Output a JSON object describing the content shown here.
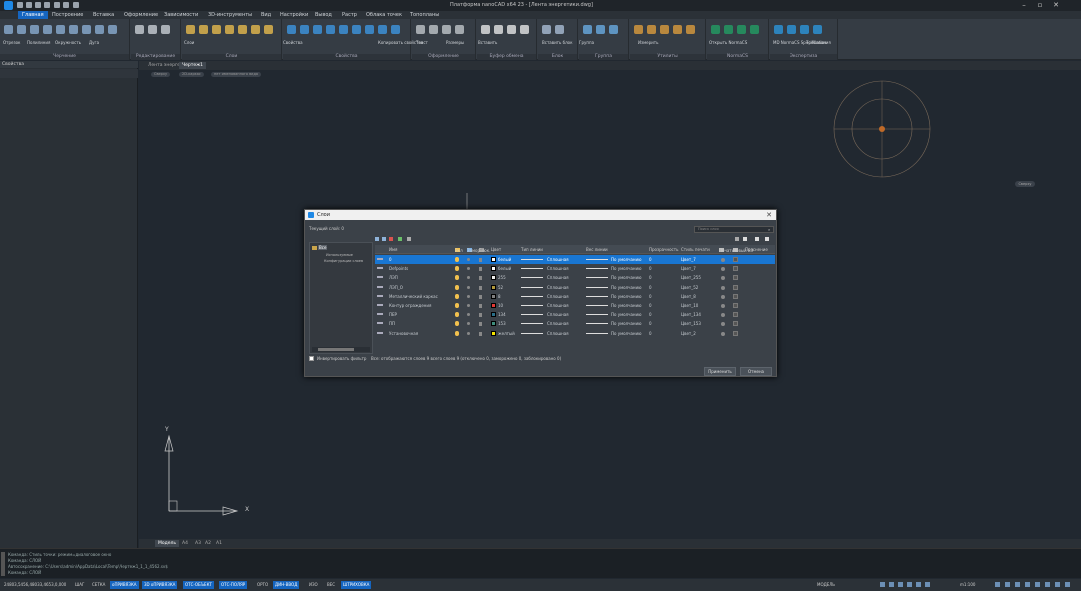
{
  "window": {
    "title": "Платформа nanoCAD x64 23 - [Лента энергетики.dwg]"
  },
  "menu": {
    "items": [
      "Главная",
      "Построение",
      "Вставка",
      "Оформление",
      "Зависимости",
      "3D-инструменты",
      "Вид",
      "Настройки",
      "Вывод",
      "Растр",
      "Облака точек",
      "Топопланы"
    ],
    "active": "Главная"
  },
  "ribbon": {
    "groups": [
      "Черчение",
      "Редактирование",
      "Слои",
      "Свойства",
      "Оформление",
      "Буфер обмена",
      "Блок",
      "Группа",
      "Утилиты",
      "NormaCS",
      "Экспертиза"
    ],
    "buttons": [
      "Отрезок",
      "Полилиния",
      "Окружность",
      "Дуга",
      "Слои",
      "Свойства",
      "Копировать свойства",
      "Текст",
      "Размеры",
      "Вставить",
      "Вставить блок",
      "Группа",
      "Измерить",
      "Открыть NormaCS",
      "MD NormaCS Specification",
      "Требования"
    ]
  },
  "left_panel": {
    "title": "Свойства"
  },
  "document": {
    "tabs": [
      "Лента энергетики",
      "Чертеж1"
    ],
    "active_tab": "Чертеж1",
    "breadcrumbs": [
      "Сверху",
      "2D-каркас",
      "нет именованного вида"
    ]
  },
  "viewcube": {
    "label": "Сверху"
  },
  "ucs": {
    "x_label": "X",
    "y_label": "Y"
  },
  "layout_tabs": {
    "items": [
      "Модель",
      "А4",
      "А3",
      "А2",
      "А1"
    ],
    "active": "Модель"
  },
  "command_lines": [
    "Команда: Стиль точки: режим=диалоговое окно",
    "Команда: СЛОЙ",
    "Автосохранение: C:\\Users\\admin\\AppData\\Local\\Temp\\Чертеж1_1_1_4562.sv$",
    "Команда: СЛОЙ"
  ],
  "status": {
    "coords": "24803,5456,48033,4653,0,000",
    "toggles": [
      {
        "label": "ШАГ",
        "on": false
      },
      {
        "label": "СЕТКА",
        "on": false
      },
      {
        "label": "оПРИВЯЗКА",
        "on": true
      },
      {
        "label": "3D оПРИВЯЗКА",
        "on": true
      },
      {
        "label": "ОТС-ОБЪЕКТ",
        "on": true
      },
      {
        "label": "ОТС-ПОЛЯР",
        "on": true
      },
      {
        "label": "ОРТО",
        "on": false
      },
      {
        "label": "ДИН-ВВОД",
        "on": true
      },
      {
        "label": "ИЗО",
        "on": false
      },
      {
        "label": "ВЕС",
        "on": false
      },
      {
        "label": "ШТРИХОВКА",
        "on": true
      }
    ],
    "space": "МОДЕЛЬ",
    "scale": "m1:100"
  },
  "layers_dialog": {
    "title": "Слои",
    "current_layer": "Текущий слой: 0",
    "search_placeholder": "Поиск слоя",
    "tree": {
      "root": "Все",
      "children": [
        "Используемые",
        "Конфигурации слоев"
      ]
    },
    "columns": [
      "Имя",
      "Вкл",
      "Замороз.",
      "Блок.",
      "Цвет",
      "Тип линии",
      "Вес линии",
      "Прозрачность",
      "Стиль печати",
      "Печать",
      "Новый ВЭ",
      "Пояснение"
    ],
    "layers": [
      {
        "name": "0",
        "color_name": "белый",
        "color": "#ffffff",
        "linetype": "Сплошная",
        "lineweight": "По умолчанию",
        "transparency": "0",
        "plotstyle": "Цвет_7",
        "selected": true
      },
      {
        "name": "Defpoints",
        "color_name": "белый",
        "color": "#ffffff",
        "linetype": "Сплошная",
        "lineweight": "По умолчанию",
        "transparency": "0",
        "plotstyle": "Цвет_7",
        "selected": false
      },
      {
        "name": "ЛЭП",
        "color_name": "255",
        "color": "#f0f0f0",
        "linetype": "Сплошная",
        "lineweight": "По умолчанию",
        "transparency": "0",
        "plotstyle": "Цвет_255",
        "selected": false
      },
      {
        "name": "ЛЭП_О",
        "color_name": "52",
        "color": "#b29a3c",
        "linetype": "Сплошная",
        "lineweight": "По умолчанию",
        "transparency": "0",
        "plotstyle": "Цвет_52",
        "selected": false
      },
      {
        "name": "Металлический каркас",
        "color_name": "8",
        "color": "#808080",
        "linetype": "Сплошная",
        "lineweight": "По умолчанию",
        "transparency": "0",
        "plotstyle": "Цвет_8",
        "selected": false
      },
      {
        "name": "Контур ограждения",
        "color_name": "10",
        "color": "#e53935",
        "linetype": "Сплошная",
        "lineweight": "По умолчанию",
        "transparency": "0",
        "plotstyle": "Цвет_10",
        "selected": false
      },
      {
        "name": "ПЕР",
        "color_name": "134",
        "color": "#2a6f8a",
        "linetype": "Сплошная",
        "lineweight": "По умолчанию",
        "transparency": "0",
        "plotstyle": "Цвет_134",
        "selected": false
      },
      {
        "name": "ПП",
        "color_name": "153",
        "color": "#3e8e7e",
        "linetype": "Сплошная",
        "lineweight": "По умолчанию",
        "transparency": "0",
        "plotstyle": "Цвет_153",
        "selected": false
      },
      {
        "name": "Установочная",
        "color_name": "желтый",
        "color": "#f5e400",
        "linetype": "Сплошная",
        "lineweight": "По умолчанию",
        "transparency": "0",
        "plotstyle": "Цвет_2",
        "selected": false
      }
    ],
    "invert_filter_label": "Инвертировать фильтр",
    "summary": "Все: отображаются слоев 9 всего слоев 9 (отключено 0, заморожено 0, заблокировано 0)",
    "apply_label": "Применить",
    "ok_label": "Отмена"
  }
}
